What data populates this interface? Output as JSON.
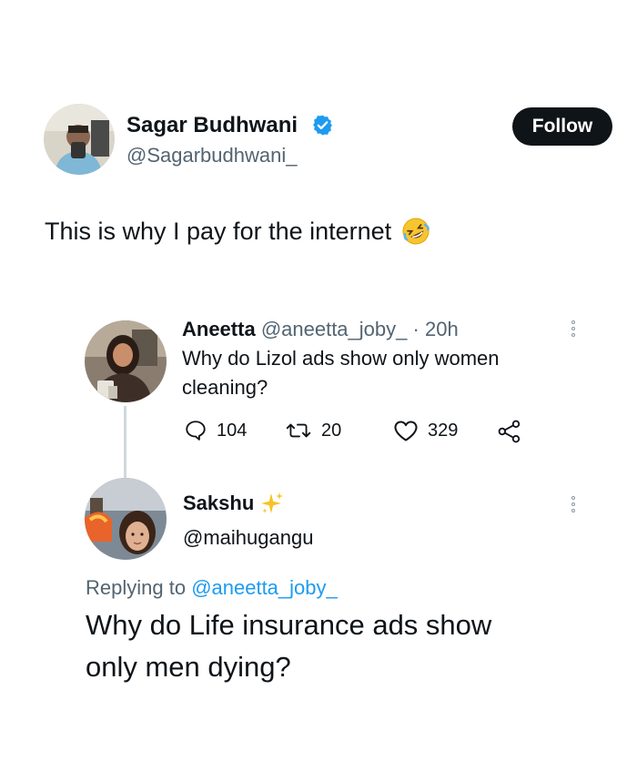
{
  "main_tweet": {
    "author_name": "Sagar Budhwani",
    "author_handle": "@Sagarbudhwani_",
    "verified": true,
    "follow_label": "Follow",
    "text": "This is why I pay for the internet",
    "emoji": "🤣",
    "emoji_icon": "rolling-on-floor-laughing-emoji"
  },
  "reply_tweet": {
    "author_name": "Aneetta",
    "author_handle": "@aneetta_joby_",
    "separator": "·",
    "time": "20h",
    "text_line1": "Why do Lizol ads show only women",
    "text_line2": "cleaning?",
    "replies": "104",
    "retweets": "20",
    "likes": "329"
  },
  "second_reply": {
    "author_name": "Sakshu",
    "author_handle": "@maihugangu",
    "sparkle_icon": "sparkles-emoji",
    "replying_prefix": "Replying to ",
    "replying_handle": "@aneetta_joby_",
    "text_line1": "Why do Life insurance ads show",
    "text_line2": "only men dying?"
  },
  "colors": {
    "text": "#0f1419",
    "muted": "#536471",
    "link": "#1d9bf0",
    "verified": "#1d9bf0",
    "follow_bg": "#0f1419"
  }
}
